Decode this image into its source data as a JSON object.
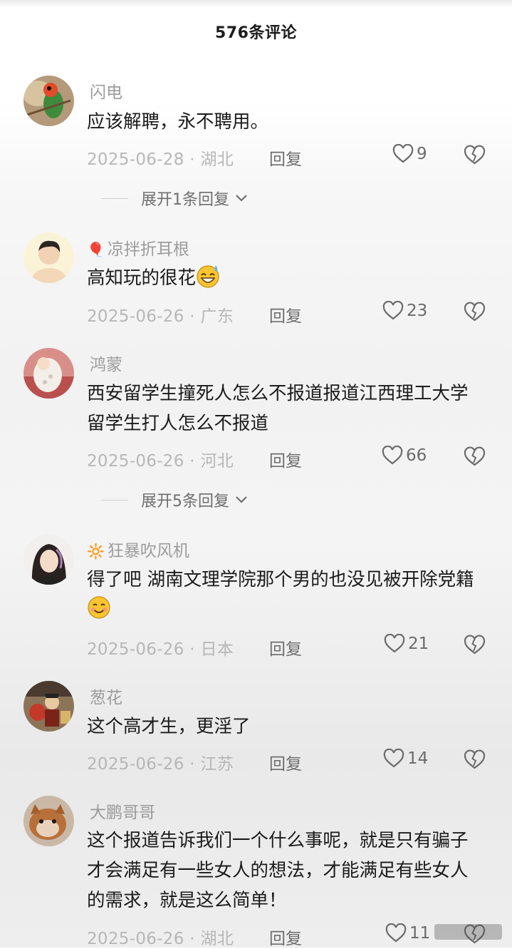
{
  "header": {
    "title": "576条评论"
  },
  "comments": [
    {
      "user": "闪电",
      "badge": "",
      "text": "应该解聘，永不聘用。",
      "date": "2025-06-28",
      "location": "湖北",
      "reply": "回复",
      "likes": "9",
      "expand": "展开1条回复"
    },
    {
      "user": "凉拌折耳根",
      "badge": "🎈",
      "text": "高知玩的很花",
      "emoji": "sweat-smile-emoji",
      "date": "2025-06-26",
      "location": "广东",
      "reply": "回复",
      "likes": "23"
    },
    {
      "user": "鸿蒙",
      "badge": "",
      "text": "西安留学生撞死人怎么不报道报道江西理工大学留学生打人怎么不报道",
      "date": "2025-06-26",
      "location": "河北",
      "reply": "回复",
      "likes": "66",
      "expand": "展开5条回复"
    },
    {
      "user": "狂暴吹风机",
      "badge": "🔆",
      "text": "得了吧 湖南文理学院那个男的也没见被开除党籍",
      "emoji": "smile-emoji",
      "date": "2025-06-26",
      "location": "日本",
      "reply": "回复",
      "likes": "21"
    },
    {
      "user": "葱花",
      "badge": "",
      "text": "这个高才生，更淫了",
      "date": "2025-06-26",
      "location": "江苏",
      "reply": "回复",
      "likes": "14"
    },
    {
      "user": "大鹏哥哥",
      "badge": "",
      "text": "这个报道告诉我们一个什么事呢，就是只有骗子才会满足有一些女人的想法，才能满足有些女人的需求，就是这么简单！",
      "date": "2025-06-26",
      "location": "湖北",
      "reply": "回复",
      "likes": "11"
    }
  ],
  "meta_separator": " · ",
  "icons": {
    "like": "heart-outline-icon",
    "dislike": "broken-heart-icon",
    "expand": "chevron-down-icon"
  },
  "colors": {
    "username": "#9c9c9c",
    "meta": "#b7b7b7",
    "text": "#1b1b1b"
  }
}
